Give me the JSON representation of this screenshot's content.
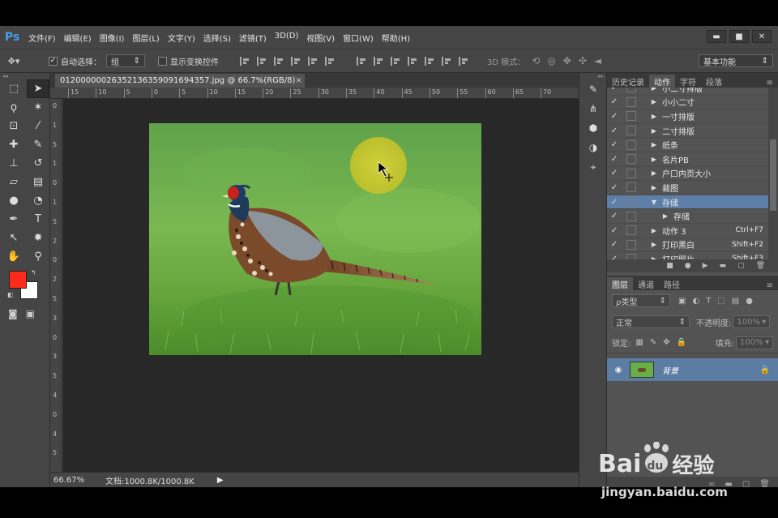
{
  "app": {
    "logo": "Ps"
  },
  "menu": [
    "文件(F)",
    "编辑(E)",
    "图像(I)",
    "图层(L)",
    "文字(Y)",
    "选择(S)",
    "滤镜(T)",
    "3D(D)",
    "视图(V)",
    "窗口(W)",
    "帮助(H)"
  ],
  "window_buttons": [
    "▬",
    "■",
    "✕"
  ],
  "options": {
    "auto_select_label": "自动选择：",
    "auto_select_value": "组",
    "show_transform_label": "显示变换控件",
    "mode_3d_label": "3D 模式：",
    "workspace": "基本功能"
  },
  "document": {
    "tab_title": "012000000263521363590916943​57.jpg @ 66.7%(RGB/8)",
    "close_icon": "×",
    "zoom": "66.67%",
    "doc_info": "文档:1000.8K/1000.8K"
  },
  "ruler": {
    "h_ticks": [
      "15",
      "10",
      "5",
      "0",
      "5",
      "10",
      "15",
      "20",
      "25",
      "30",
      "35",
      "40",
      "45",
      "50",
      "55",
      "60",
      "65",
      "70"
    ],
    "v_ticks": [
      "0",
      "1",
      "5",
      "1",
      "0",
      "1",
      "5",
      "2",
      "0",
      "2",
      "5",
      "3",
      "0",
      "3",
      "5",
      "4",
      "0",
      "4",
      "5"
    ]
  },
  "panel_tabs_top": [
    "历史记录",
    "动作",
    "字符",
    "段落"
  ],
  "actions": [
    {
      "label": "小二寸排版",
      "shortcut": "",
      "expanded": false,
      "indent": 0
    },
    {
      "label": "小小二寸",
      "shortcut": "",
      "expanded": false,
      "indent": 0
    },
    {
      "label": "一寸排版",
      "shortcut": "",
      "expanded": false,
      "indent": 0
    },
    {
      "label": "二寸排版",
      "shortcut": "",
      "expanded": false,
      "indent": 0
    },
    {
      "label": "纸条",
      "shortcut": "",
      "expanded": false,
      "indent": 0
    },
    {
      "label": "名片PB",
      "shortcut": "",
      "expanded": false,
      "indent": 0
    },
    {
      "label": "户口内页大小",
      "shortcut": "",
      "expanded": false,
      "indent": 0
    },
    {
      "label": "裁图",
      "shortcut": "",
      "expanded": false,
      "indent": 0
    },
    {
      "label": "存储",
      "shortcut": "",
      "expanded": true,
      "indent": 0,
      "selected": true
    },
    {
      "label": "存储",
      "shortcut": "",
      "expanded": false,
      "indent": 1
    },
    {
      "label": "动作 3",
      "shortcut": "Ctrl+F7",
      "expanded": false,
      "indent": 0
    },
    {
      "label": "打印黑白",
      "shortcut": "Shift+F2",
      "expanded": false,
      "indent": 0
    },
    {
      "label": "打印照片",
      "shortcut": "Shift+F3",
      "expanded": false,
      "indent": 0
    }
  ],
  "panel_tabs_bottom": [
    "图层",
    "通道",
    "路径"
  ],
  "layers": {
    "filter_label": "ρ类型",
    "blend_mode": "正常",
    "opacity_label": "不透明度:",
    "opacity_value": "100%",
    "lock_label": "锁定:",
    "fill_label": "填充:",
    "fill_value": "100%",
    "layer_name": "背景"
  },
  "colors": {
    "foreground": "#ff2a1a",
    "background": "#ffffff",
    "selection": "#5d7fa8",
    "ps_blue": "#4a9de8"
  },
  "watermark": {
    "brand_left": "Bai",
    "brand_du": "du",
    "brand_right": "经验",
    "url": "jingyan.baidu.com"
  }
}
